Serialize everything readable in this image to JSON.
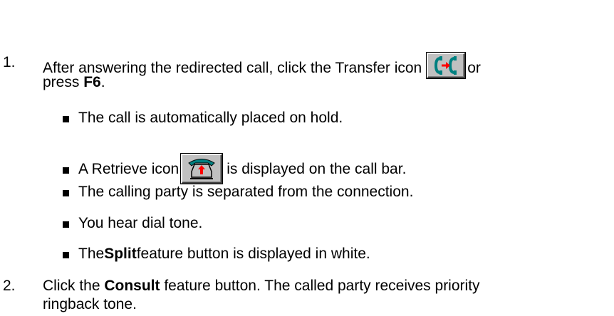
{
  "steps": [
    {
      "number": "1.",
      "text_before_icon": "After answering the redirected call, click the Transfer icon",
      "text_after_icon": "or",
      "line2_prefix": "press ",
      "key": "F6",
      "line2_suffix": ".",
      "icon": "transfer-icon",
      "bullets": [
        {
          "text": "The call is automatically placed on hold."
        },
        {
          "before": "A Retrieve icon",
          "icon": "retrieve-icon",
          "after": "is displayed on the call bar."
        },
        {
          "text": "The calling party is separated from the connection."
        },
        {
          "text": "You hear dial tone."
        },
        {
          "before": "The ",
          "bold": "Split",
          "after": " feature button is displayed in white."
        }
      ]
    },
    {
      "number": "2.",
      "line1_prefix": "Click the ",
      "bold": "Consult",
      "line1_suffix": " feature button.  The called party receives priority",
      "line2": "ringback tone."
    }
  ],
  "colors": {
    "text": "#000000",
    "button_face": "#c0c0c0",
    "icon_teal": "#008080",
    "icon_red": "#ff0000"
  }
}
